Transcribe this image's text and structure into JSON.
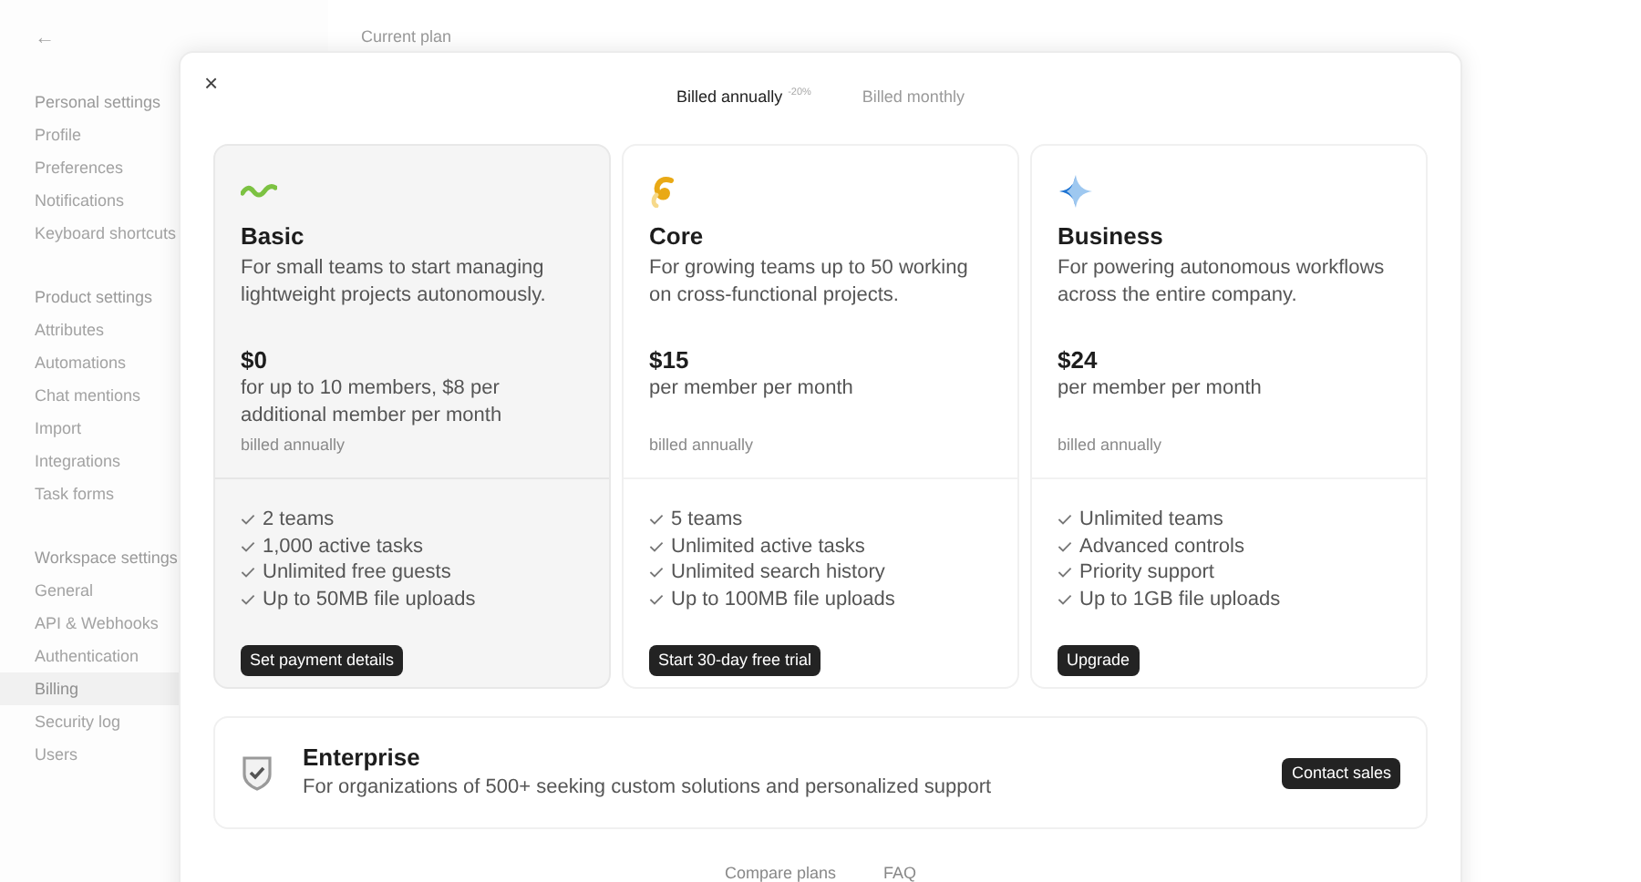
{
  "back": {
    "icon": "←"
  },
  "sidebar": {
    "sections": [
      {
        "title": "Personal settings",
        "items": [
          {
            "label": "Profile",
            "selected": false
          },
          {
            "label": "Preferences",
            "selected": false
          },
          {
            "label": "Notifications",
            "selected": false
          },
          {
            "label": "Keyboard shortcuts",
            "selected": false
          }
        ]
      },
      {
        "title": "Product settings",
        "items": [
          {
            "label": "Attributes",
            "selected": false
          },
          {
            "label": "Automations",
            "selected": false
          },
          {
            "label": "Chat mentions",
            "selected": false
          },
          {
            "label": "Import",
            "selected": false
          },
          {
            "label": "Integrations",
            "selected": false
          },
          {
            "label": "Task forms",
            "selected": false
          }
        ]
      },
      {
        "title": "Workspace settings",
        "items": [
          {
            "label": "General",
            "selected": false
          },
          {
            "label": "API & Webhooks",
            "selected": false
          },
          {
            "label": "Authentication",
            "selected": false
          },
          {
            "label": "Billing",
            "selected": true
          },
          {
            "label": "Security log",
            "selected": false
          },
          {
            "label": "Users",
            "selected": false
          }
        ]
      }
    ]
  },
  "page": {
    "heading": "Current plan"
  },
  "modal": {
    "close": "×",
    "billing_tabs": [
      {
        "label": "Billed annually",
        "badge": "-20%",
        "selected": true
      },
      {
        "label": "Billed monthly",
        "selected": false
      }
    ],
    "plans": [
      {
        "kind": "wave",
        "name": "Basic",
        "current": true,
        "description": "For small teams to start managing lightweight projects autonomously.",
        "price": "$0",
        "price_note": "for up to 10 members, $8 per additional member per month",
        "billing": "billed annually",
        "features": [
          "2 teams",
          "1,000 active tasks",
          "Unlimited free guests",
          "Up to 50MB file uploads"
        ],
        "button": "Set payment details"
      },
      {
        "kind": "swirl",
        "name": "Core",
        "current": false,
        "description": "For growing teams up to 50 working on cross-functional projects.",
        "price": "$15",
        "price_note": "per member per month",
        "billing": "billed annually",
        "features": [
          "5 teams",
          "Unlimited active tasks",
          "Unlimited search history",
          "Up to 100MB file uploads"
        ],
        "button": "Start 30-day free trial"
      },
      {
        "kind": "sparkle",
        "name": "Business",
        "current": false,
        "description": "For powering autonomous workflows across the entire company.",
        "price": "$24",
        "price_note": "per member per month",
        "billing": "billed annually",
        "features": [
          "Unlimited teams",
          "Advanced controls",
          "Priority support",
          "Up to 1GB file uploads"
        ],
        "button": "Upgrade"
      }
    ],
    "enterprise": {
      "name": "Enterprise",
      "description": "For organizations of 500+ seeking custom solutions and personalized support",
      "button": "Contact sales"
    },
    "footer_links": [
      "Compare plans",
      "FAQ"
    ]
  }
}
